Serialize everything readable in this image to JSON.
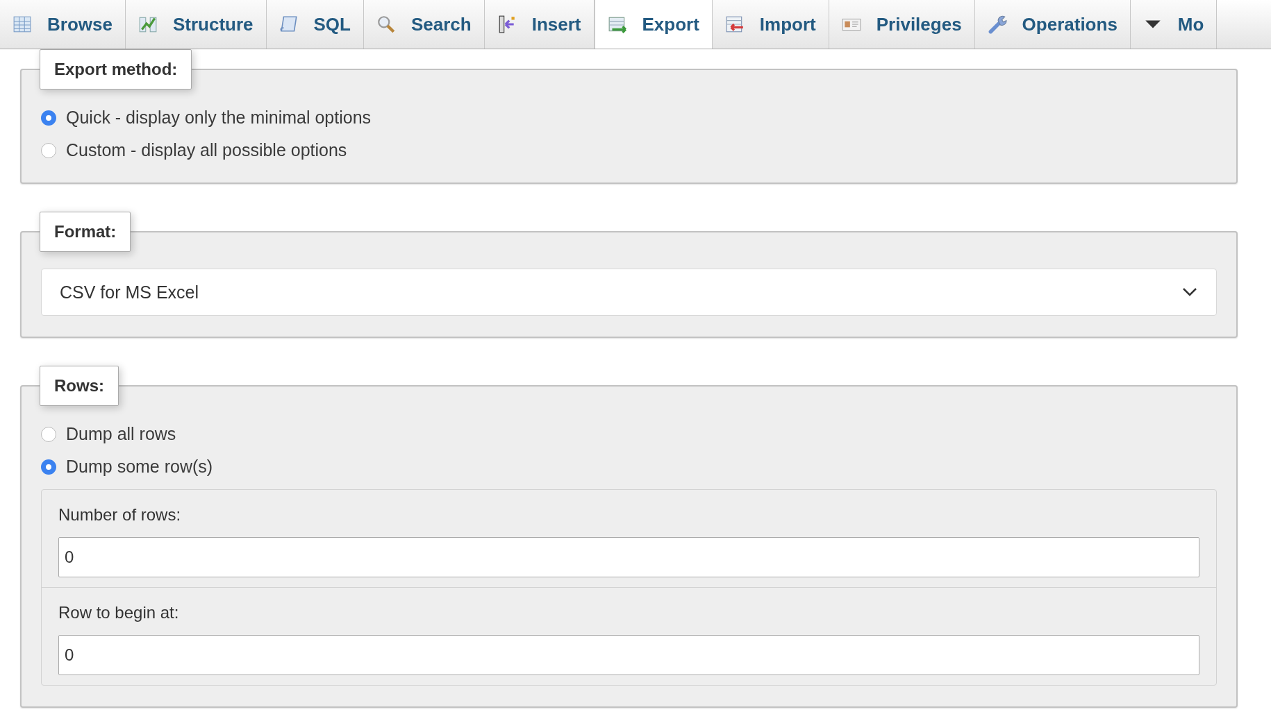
{
  "tabs": [
    {
      "label": "Browse",
      "selected": false,
      "kind": "tab"
    },
    {
      "label": "Structure",
      "selected": false,
      "kind": "tab"
    },
    {
      "label": "SQL",
      "selected": false,
      "kind": "tab"
    },
    {
      "label": "Search",
      "selected": false,
      "kind": "tab"
    },
    {
      "label": "Insert",
      "selected": false,
      "kind": "tab"
    },
    {
      "label": "Export",
      "selected": true,
      "kind": "tab"
    },
    {
      "label": "Import",
      "selected": false,
      "kind": "tab"
    },
    {
      "label": "Privileges",
      "selected": false,
      "kind": "tab"
    },
    {
      "label": "Operations",
      "selected": false,
      "kind": "tab"
    },
    {
      "label": "Mo",
      "selected": false,
      "kind": "menu"
    }
  ],
  "export_method": {
    "legend": "Export method:",
    "options": [
      {
        "label": "Quick - display only the minimal options",
        "selected": true
      },
      {
        "label": "Custom - display all possible options",
        "selected": false
      }
    ]
  },
  "format": {
    "legend": "Format:",
    "value": "CSV for MS Excel"
  },
  "rows": {
    "legend": "Rows:",
    "options": [
      {
        "label": "Dump all rows",
        "selected": false
      },
      {
        "label": "Dump some row(s)",
        "selected": true
      }
    ],
    "fields": [
      {
        "label": "Number of rows:",
        "value": "0"
      },
      {
        "label": "Row to begin at:",
        "value": "0"
      }
    ]
  }
}
